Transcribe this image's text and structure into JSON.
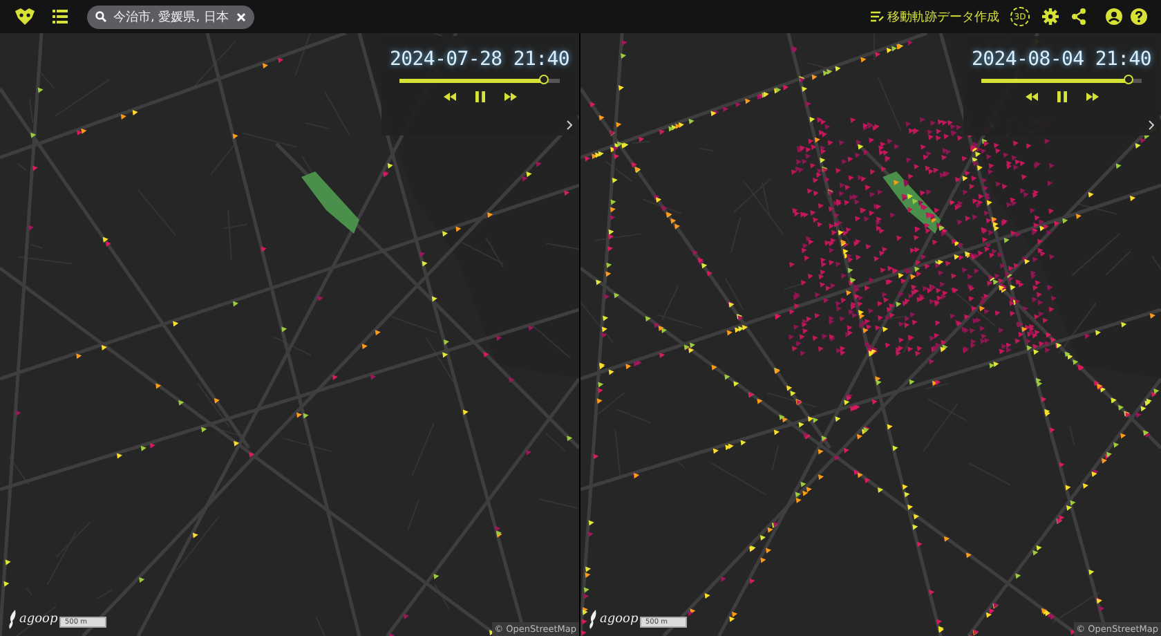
{
  "toolbar": {
    "search": {
      "value": "今治市, 愛媛県, 日本"
    },
    "create_button": "移動軌跡データ作成",
    "mode_3d": "3D"
  },
  "panels": [
    {
      "timestamp": "2024-07-28 21:40",
      "level": 0.9,
      "playing": true,
      "kind": "sparse",
      "brand": "agoop",
      "scale": "500 m",
      "attribution": "© OpenStreetMap"
    },
    {
      "timestamp": "2024-08-04 21:40",
      "level": 0.92,
      "playing": true,
      "kind": "dense",
      "brand": "agoop",
      "scale": "500 m",
      "attribution": "© OpenStreetMap"
    }
  ]
}
